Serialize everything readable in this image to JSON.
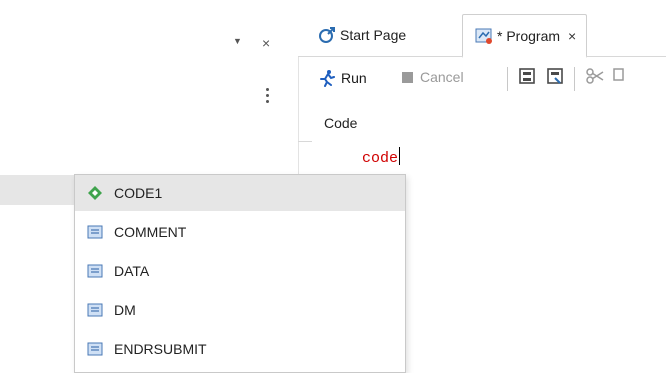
{
  "tabs": [
    {
      "label": "Start Page",
      "icon": "start-page-icon"
    },
    {
      "label": "* Program",
      "icon": "program-icon",
      "close": "×"
    }
  ],
  "panel": {
    "pin": "▼",
    "close": "×"
  },
  "toolbar": {
    "run_label": "Run",
    "cancel_label": "Cancel"
  },
  "subtabs": {
    "code_label": "Code"
  },
  "editor": {
    "text": "code",
    "text_color": "#d00000"
  },
  "autocomplete": {
    "items": [
      {
        "label": "CODE1",
        "icon": "snippet-diamond-icon",
        "selected": true
      },
      {
        "label": "COMMENT",
        "icon": "keyword-icon"
      },
      {
        "label": "DATA",
        "icon": "keyword-icon"
      },
      {
        "label": "DM",
        "icon": "keyword-icon"
      },
      {
        "label": "ENDRSUBMIT",
        "icon": "keyword-icon"
      }
    ]
  },
  "colors": {
    "accent_blue": "#2b6cb0",
    "run_blue": "#1f5fbf",
    "diamond_green": "#3fa34d",
    "code_red": "#d00000"
  }
}
